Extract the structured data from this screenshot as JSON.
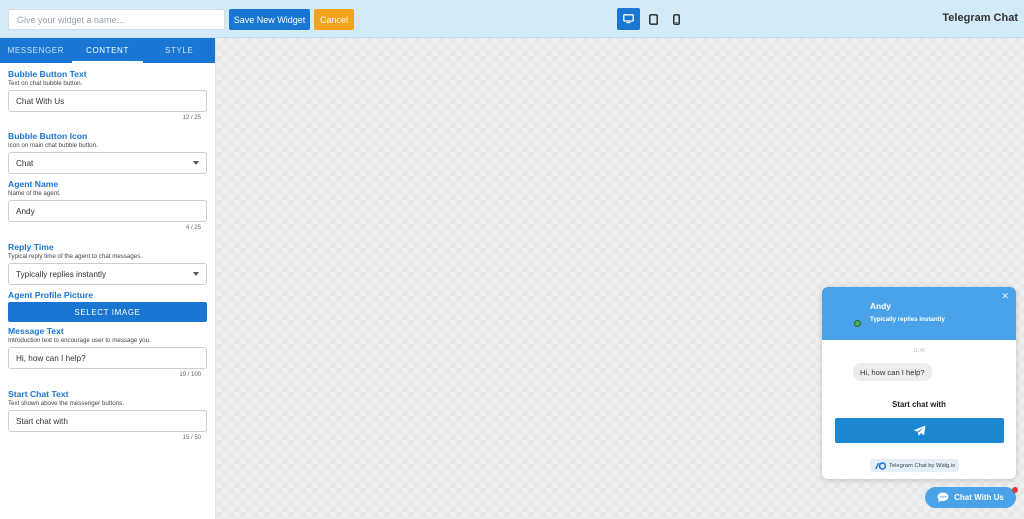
{
  "topbar": {
    "name_placeholder": "Give your widget a name...",
    "save_label": "Save New Widget",
    "cancel_label": "Cancel",
    "app_title": "Telegram Chat",
    "devices": [
      "desktop-icon",
      "tablet-icon",
      "mobile-icon"
    ],
    "active_device": "desktop"
  },
  "sidebar": {
    "tabs": [
      {
        "label": "MESSENGER"
      },
      {
        "label": "CONTENT",
        "active": true
      },
      {
        "label": "STYLE"
      }
    ],
    "fields": {
      "bubble_text": {
        "title": "Bubble Button Text",
        "desc": "Text on chat bubble button.",
        "value": "Chat With Us",
        "count": "12 / 25"
      },
      "bubble_icon": {
        "title": "Bubble Button Icon",
        "desc": "Icon on main chat bubble button.",
        "value": "Chat"
      },
      "agent_name": {
        "title": "Agent Name",
        "desc": "Name of the agent.",
        "value": "Andy",
        "count": "4 / 25"
      },
      "reply_time": {
        "title": "Reply Time",
        "desc": "Typical reply time of the agent to chat messages.",
        "value": "Typically replies instantly"
      },
      "profile_picture": {
        "title": "Agent Profile Picture",
        "button": "SELECT IMAGE"
      },
      "message_text": {
        "title": "Message Text",
        "desc": "Introduction text to encourage user to message you.",
        "value": "Hi, how can I help?",
        "count": "19 / 100"
      },
      "start_chat": {
        "title": "Start Chat Text",
        "desc": "Text shown above the messenger buttons.",
        "value": "Start chat with",
        "count": "15 / 50"
      }
    }
  },
  "widget": {
    "agent_name": "Andy",
    "reply_time": "Typically replies instantly",
    "time": "11:46",
    "message": "Hi, how can I help?",
    "start_chat": "Start chat with",
    "powered_by": "Telegram Chat by Widg.io",
    "bubble_label": "Chat With Us",
    "colors": {
      "header": "#4aa3e8",
      "button": "#1b86d1",
      "online": "#4caf50"
    }
  },
  "colors": {
    "primary": "#1976d2",
    "cancel": "#f6a21a",
    "topbar": "#d3eaf8"
  }
}
